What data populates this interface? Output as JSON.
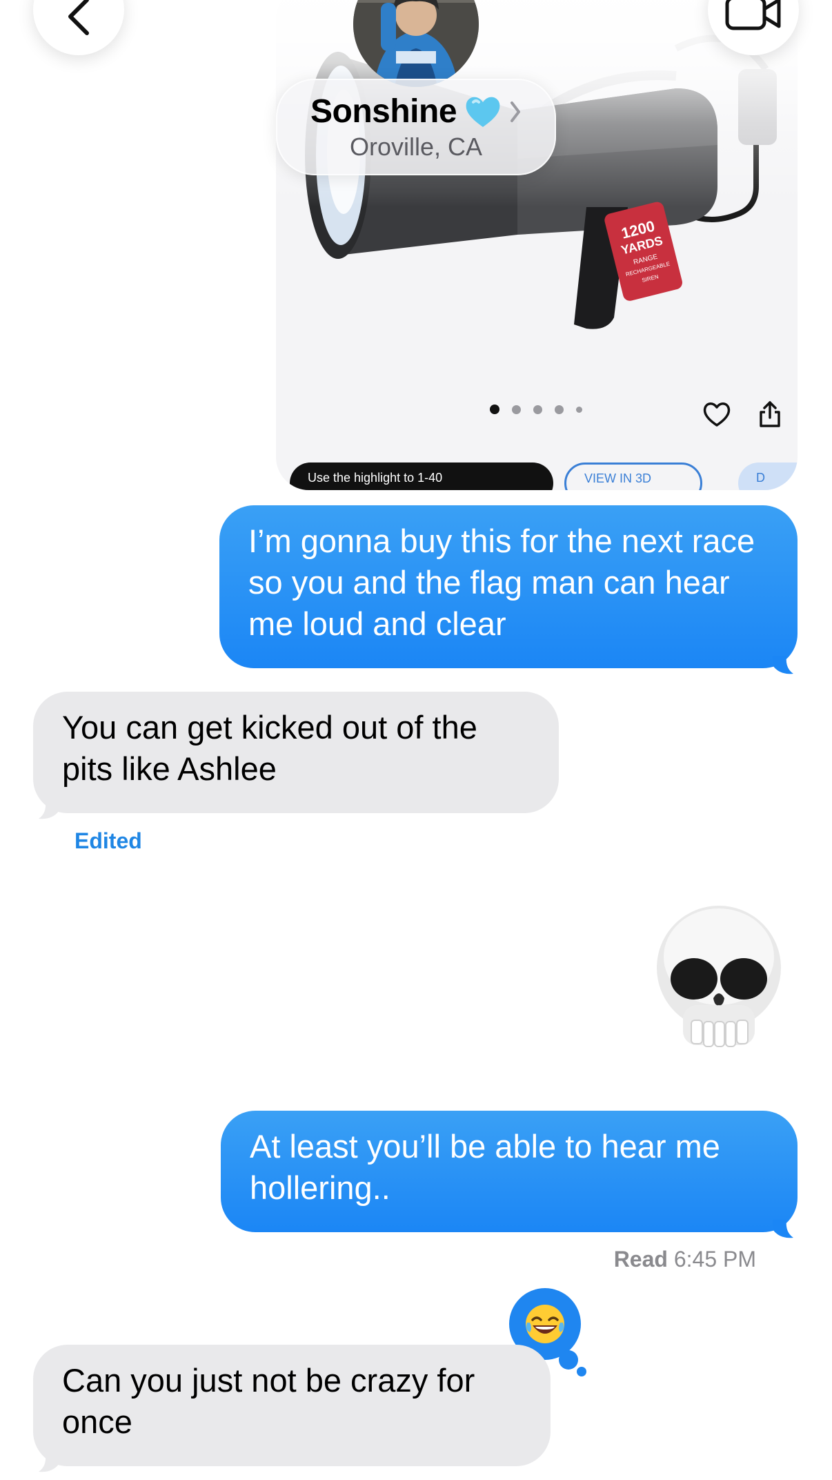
{
  "header": {
    "contact_name": "Sonshine",
    "contact_emoji": "🩵",
    "contact_location": "Oroville, CA",
    "icons": {
      "back": "chevron-left-icon",
      "video": "video-camera-icon",
      "chevron": "chevron-right-icon"
    }
  },
  "product_card": {
    "tag_line1": "1200",
    "tag_line2": "YARDS",
    "tag_line3": "RANGE",
    "tag_line4": "RECHARGEABLE",
    "tag_line5": "SIREN",
    "chips": [
      "Use the highlight to 1-40",
      "VIEW IN 3D",
      "D"
    ],
    "carousel": {
      "count": 5,
      "active_index": 0
    }
  },
  "messages": [
    {
      "direction": "sent",
      "text": "I’m gonna buy this for the next race so you and the flag man can hear me loud and clear"
    },
    {
      "direction": "received",
      "text": "You can get kicked out of the pits like Ashlee",
      "status": "Edited"
    },
    {
      "direction": "sent",
      "type": "emoji",
      "text": "💀"
    },
    {
      "direction": "sent",
      "text": "At least you’ll be able to hear me hollering..",
      "receipt_label": "Read",
      "receipt_time": "6:45 PM"
    },
    {
      "direction": "received",
      "text": "Can you just not be crazy for once",
      "tapback": "😂"
    }
  ],
  "colors": {
    "sent_bubble": "#1b86f5",
    "received_bubble": "#e9e9eb",
    "link_blue": "#1f86e4"
  }
}
